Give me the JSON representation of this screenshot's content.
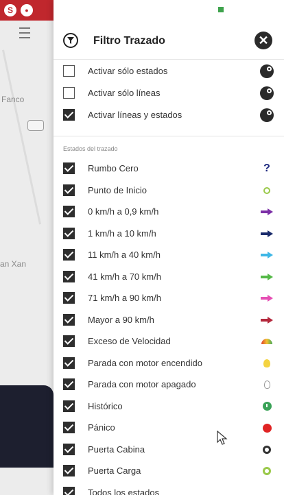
{
  "map": {
    "badge_left": "S",
    "badge_right": "●",
    "label_a": "Fanco",
    "label_b": "an Xan"
  },
  "header": {
    "title": "Filtro Trazado",
    "filter_icon": "filter-funnel-icon",
    "close_icon": "close-x-icon"
  },
  "options": [
    {
      "label": "Activar sólo estados",
      "checked": false,
      "icon": "toggle-states-icon"
    },
    {
      "label": "Activar sólo líneas",
      "checked": false,
      "icon": "toggle-lines-icon"
    },
    {
      "label": "Activar líneas y estados",
      "checked": true,
      "icon": "toggle-both-icon"
    }
  ],
  "section_label": "Estados del trazado",
  "states": [
    {
      "label": "Rumbo Cero",
      "checked": true,
      "icon": "question-icon"
    },
    {
      "label": "Punto de Inicio",
      "checked": true,
      "icon": "start-ring-icon"
    },
    {
      "label": "0 km/h a 0,9 km/h",
      "checked": true,
      "icon": "arrow-icon",
      "color": "#7b2fa6"
    },
    {
      "label": "1 km/h a 10 km/h",
      "checked": true,
      "icon": "arrow-icon",
      "color": "#1a2b6b"
    },
    {
      "label": "11 km/h a 40 km/h",
      "checked": true,
      "icon": "arrow-icon",
      "color": "#3fb7e6"
    },
    {
      "label": "41 km/h a 70 km/h",
      "checked": true,
      "icon": "arrow-icon",
      "color": "#55b948"
    },
    {
      "label": "71 km/h a 90 km/h",
      "checked": true,
      "icon": "arrow-icon",
      "color": "#e64fb4"
    },
    {
      "label": "Mayor a 90 km/h",
      "checked": true,
      "icon": "arrow-icon",
      "color": "#b4283c"
    },
    {
      "label": "Exceso de Velocidad",
      "checked": true,
      "icon": "speedometer-icon"
    },
    {
      "label": "Parada con motor encendido",
      "checked": true,
      "icon": "bulb-on-icon"
    },
    {
      "label": "Parada con motor apagado",
      "checked": true,
      "icon": "bulb-off-icon"
    },
    {
      "label": "Histórico",
      "checked": true,
      "icon": "history-clock-icon"
    },
    {
      "label": "Pánico",
      "checked": true,
      "icon": "panic-icon"
    },
    {
      "label": "Puerta Cabina",
      "checked": true,
      "icon": "door-cabin-icon"
    },
    {
      "label": "Puerta Carga",
      "checked": true,
      "icon": "door-cargo-icon"
    },
    {
      "label": "Todos los estados",
      "checked": true,
      "icon": ""
    }
  ]
}
